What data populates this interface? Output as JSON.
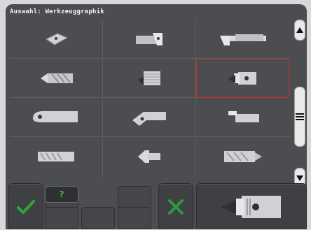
{
  "title": "Auswahl: Werkzeuggraphik",
  "grid": {
    "rows": 4,
    "cols": 3,
    "selected": {
      "row": 1,
      "col": 2
    },
    "tool_icons": [
      "tool-insert-icon",
      "tool-holder-insert-icon",
      "tool-boring-bar-icon",
      "tool-drill-icon",
      "tool-threading-icon",
      "tool-selected-boring-icon",
      "tool-grooving-icon",
      "tool-angled-holder-icon",
      "tool-parting-icon",
      "tool-tap-icon",
      "tool-countersink-icon",
      "tool-reamer-icon"
    ]
  },
  "scroll": {
    "up_icon": "triangle-up-icon",
    "middle_icon": "menu-lines-icon",
    "down_icon": "triangle-down-icon"
  },
  "bottom": {
    "confirm_icon": "check-icon",
    "help_label": "?",
    "cancel_icon": "x-icon",
    "preview_icon": "tool-preview-icon"
  },
  "colors": {
    "screen_bg": "#4c4d50",
    "grid_line": "#5d5f63",
    "selection": "#c4322e",
    "confirm_green": "#2fa63a",
    "cancel_green": "#2f9a3a"
  }
}
